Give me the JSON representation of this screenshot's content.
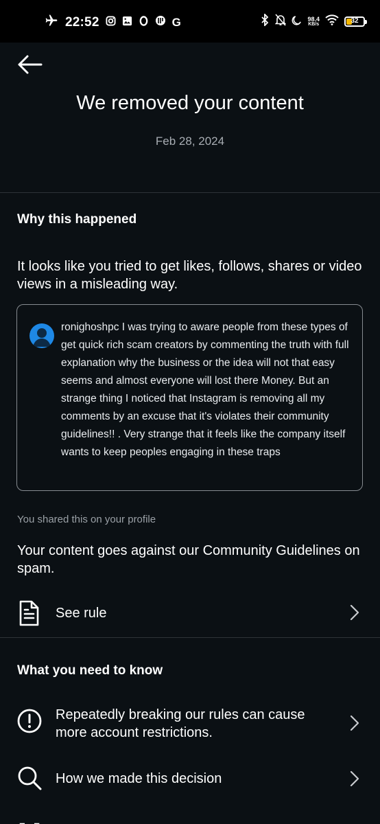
{
  "status_bar": {
    "time": "22:52",
    "notification_icons": [
      "instagram-icon",
      "gallery-icon",
      "o-icon",
      "app-icon",
      "google-icon"
    ],
    "network_speed_value": "98.4",
    "network_speed_unit": "KB/s",
    "battery_level": "32",
    "battery_color": "#f5b800"
  },
  "header": {
    "title": "We removed your content",
    "date": "Feb 28, 2024"
  },
  "why": {
    "heading": "Why this happened",
    "explanation": "It looks like you tried to get likes, follows, shares or video views in a misleading way.",
    "comment": "ronighoshpc I was trying to aware people from these types of get quick rich scam creators by commenting the truth with full explanation why the business or the idea will not that easy seems and almost everyone will lost there Money. But an strange thing I noticed that Instagram is removing all my comments by an excuse that it's violates their community guidelines!! . Very strange that it feels like the company itself wants to keep peoples engaging in these traps",
    "shared_label": "You shared this on your profile",
    "guideline_text": "Your content goes against our Community Guidelines on spam.",
    "see_rule_label": "See rule"
  },
  "know": {
    "heading": "What you need to know",
    "items": [
      {
        "label": "Repeatedly breaking our rules can cause more account restrictions.",
        "icon": "alert-circle-icon"
      },
      {
        "label": "How we made this decision",
        "icon": "search-icon"
      }
    ]
  },
  "colors": {
    "background": "#0b1014",
    "muted": "#a8adb3",
    "divider": "#2e3338",
    "avatar": "#1e88e5"
  }
}
